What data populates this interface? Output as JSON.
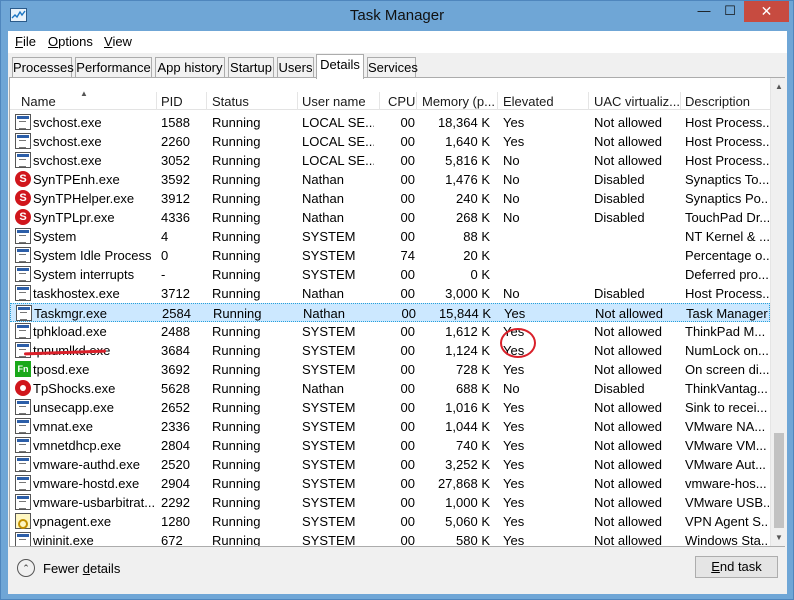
{
  "window": {
    "title": "Task Manager",
    "minimize": "—",
    "maximize": "☐",
    "close": "✕"
  },
  "menu": [
    {
      "accel": "F",
      "rest": "ile"
    },
    {
      "accel": "O",
      "rest": "ptions"
    },
    {
      "accel": "V",
      "rest": "iew"
    }
  ],
  "tabs": [
    "Processes",
    "Performance",
    "App history",
    "Startup",
    "Users",
    "Details",
    "Services"
  ],
  "active_tab": "Details",
  "columns": [
    "Name",
    "PID",
    "Status",
    "User name",
    "CPU",
    "Memory (p...",
    "Elevated",
    "UAC virtualiz...",
    "Description"
  ],
  "sort_indicator": "▲",
  "rows": [
    {
      "icon": "window-icon",
      "name": "svchost.exe",
      "pid": "1588",
      "status": "Running",
      "user": "LOCAL SE...",
      "cpu": "00",
      "mem": "18,364 K",
      "elev": "Yes",
      "uac": "Not allowed",
      "desc": "Host Process..."
    },
    {
      "icon": "window-icon",
      "name": "svchost.exe",
      "pid": "2260",
      "status": "Running",
      "user": "LOCAL SE...",
      "cpu": "00",
      "mem": "1,640 K",
      "elev": "Yes",
      "uac": "Not allowed",
      "desc": "Host Process..."
    },
    {
      "icon": "window-icon",
      "name": "svchost.exe",
      "pid": "3052",
      "status": "Running",
      "user": "LOCAL SE...",
      "cpu": "00",
      "mem": "5,816 K",
      "elev": "No",
      "uac": "Not allowed",
      "desc": "Host Process..."
    },
    {
      "icon": "synaptics-icon",
      "name": "SynTPEnh.exe",
      "pid": "3592",
      "status": "Running",
      "user": "Nathan",
      "cpu": "00",
      "mem": "1,476 K",
      "elev": "No",
      "uac": "Disabled",
      "desc": "Synaptics To..."
    },
    {
      "icon": "synaptics-icon",
      "name": "SynTPHelper.exe",
      "pid": "3912",
      "status": "Running",
      "user": "Nathan",
      "cpu": "00",
      "mem": "240 K",
      "elev": "No",
      "uac": "Disabled",
      "desc": "Synaptics Po..."
    },
    {
      "icon": "synaptics-icon",
      "name": "SynTPLpr.exe",
      "pid": "4336",
      "status": "Running",
      "user": "Nathan",
      "cpu": "00",
      "mem": "268 K",
      "elev": "No",
      "uac": "Disabled",
      "desc": "TouchPad Dr..."
    },
    {
      "icon": "window-icon",
      "name": "System",
      "pid": "4",
      "status": "Running",
      "user": "SYSTEM",
      "cpu": "00",
      "mem": "88 K",
      "elev": "",
      "uac": "",
      "desc": "NT Kernel & ..."
    },
    {
      "icon": "window-icon",
      "name": "System Idle Process",
      "pid": "0",
      "status": "Running",
      "user": "SYSTEM",
      "cpu": "74",
      "mem": "20 K",
      "elev": "",
      "uac": "",
      "desc": "Percentage o..."
    },
    {
      "icon": "window-icon",
      "name": "System interrupts",
      "pid": "-",
      "status": "Running",
      "user": "SYSTEM",
      "cpu": "00",
      "mem": "0 K",
      "elev": "",
      "uac": "",
      "desc": "Deferred pro..."
    },
    {
      "icon": "window-icon",
      "name": "taskhostex.exe",
      "pid": "3712",
      "status": "Running",
      "user": "Nathan",
      "cpu": "00",
      "mem": "3,000 K",
      "elev": "No",
      "uac": "Disabled",
      "desc": "Host Process..."
    },
    {
      "icon": "taskmgr-icon",
      "name": "Taskmgr.exe",
      "pid": "2584",
      "status": "Running",
      "user": "Nathan",
      "cpu": "00",
      "mem": "15,844 K",
      "elev": "Yes",
      "uac": "Not allowed",
      "desc": "Task Manager",
      "selected": true
    },
    {
      "icon": "window-icon",
      "name": "tphkload.exe",
      "pid": "2488",
      "status": "Running",
      "user": "SYSTEM",
      "cpu": "00",
      "mem": "1,612 K",
      "elev": "Yes",
      "uac": "Not allowed",
      "desc": "ThinkPad M..."
    },
    {
      "icon": "window-icon",
      "name": "tpnumlkd.exe",
      "pid": "3684",
      "status": "Running",
      "user": "SYSTEM",
      "cpu": "00",
      "mem": "1,124 K",
      "elev": "Yes",
      "uac": "Not allowed",
      "desc": "NumLock on..."
    },
    {
      "icon": "fn-icon",
      "name": "tposd.exe",
      "pid": "3692",
      "status": "Running",
      "user": "SYSTEM",
      "cpu": "00",
      "mem": "728 K",
      "elev": "Yes",
      "uac": "Not allowed",
      "desc": "On screen di..."
    },
    {
      "icon": "tpshocks-icon",
      "name": "TpShocks.exe",
      "pid": "5628",
      "status": "Running",
      "user": "Nathan",
      "cpu": "00",
      "mem": "688 K",
      "elev": "No",
      "uac": "Disabled",
      "desc": "ThinkVantag..."
    },
    {
      "icon": "window-icon",
      "name": "unsecapp.exe",
      "pid": "2652",
      "status": "Running",
      "user": "SYSTEM",
      "cpu": "00",
      "mem": "1,016 K",
      "elev": "Yes",
      "uac": "Not allowed",
      "desc": "Sink to recei..."
    },
    {
      "icon": "window-icon",
      "name": "vmnat.exe",
      "pid": "2336",
      "status": "Running",
      "user": "SYSTEM",
      "cpu": "00",
      "mem": "1,044 K",
      "elev": "Yes",
      "uac": "Not allowed",
      "desc": "VMware NA..."
    },
    {
      "icon": "window-icon",
      "name": "vmnetdhcp.exe",
      "pid": "2804",
      "status": "Running",
      "user": "SYSTEM",
      "cpu": "00",
      "mem": "740 K",
      "elev": "Yes",
      "uac": "Not allowed",
      "desc": "VMware VM..."
    },
    {
      "icon": "window-icon",
      "name": "vmware-authd.exe",
      "pid": "2520",
      "status": "Running",
      "user": "SYSTEM",
      "cpu": "00",
      "mem": "3,252 K",
      "elev": "Yes",
      "uac": "Not allowed",
      "desc": "VMware Aut..."
    },
    {
      "icon": "window-icon",
      "name": "vmware-hostd.exe",
      "pid": "2904",
      "status": "Running",
      "user": "SYSTEM",
      "cpu": "00",
      "mem": "27,868 K",
      "elev": "Yes",
      "uac": "Not allowed",
      "desc": "vmware-hos..."
    },
    {
      "icon": "window-icon",
      "name": "vmware-usbarbitrat...",
      "pid": "2292",
      "status": "Running",
      "user": "SYSTEM",
      "cpu": "00",
      "mem": "1,000 K",
      "elev": "Yes",
      "uac": "Not allowed",
      "desc": "VMware USB..."
    },
    {
      "icon": "vpn-icon",
      "name": "vpnagent.exe",
      "pid": "1280",
      "status": "Running",
      "user": "SYSTEM",
      "cpu": "00",
      "mem": "5,060 K",
      "elev": "Yes",
      "uac": "Not allowed",
      "desc": "VPN Agent S..."
    },
    {
      "icon": "window-icon",
      "name": "wininit.exe",
      "pid": "672",
      "status": "Running",
      "user": "SYSTEM",
      "cpu": "00",
      "mem": "580 K",
      "elev": "Yes",
      "uac": "Not allowed",
      "desc": "Windows Sta..."
    }
  ],
  "footer": {
    "fewer_accel": "d",
    "fewer_before": "Fewer ",
    "fewer_after": "etails",
    "end_accel": "E",
    "end_rest": "nd task"
  },
  "colors": {
    "selected_row": "#cce8ff",
    "annotation": "#d9202a",
    "title_bar": "#6fa6d6",
    "close_button": "#c74b40"
  }
}
